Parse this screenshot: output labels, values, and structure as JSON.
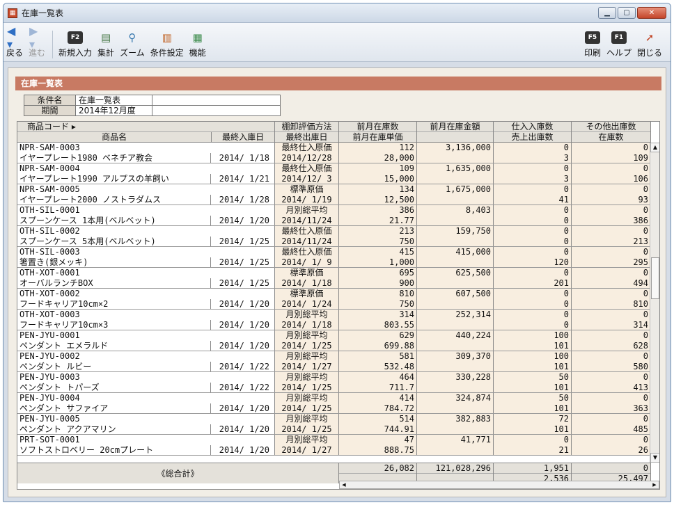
{
  "window": {
    "title": "在庫一覧表"
  },
  "toolbar": {
    "back": "戻る",
    "forward": "進む",
    "new": "新規入力",
    "total": "集計",
    "zoom": "ズーム",
    "condition": "条件設定",
    "function": "機能",
    "print": "印刷",
    "help": "ヘルプ",
    "close": "閉じる",
    "f2": "F2",
    "f5": "F5",
    "f1": "F1"
  },
  "section": {
    "title": "在庫一覧表"
  },
  "conditions": {
    "name_label": "条件名",
    "name_value": "在庫一覧表",
    "period_label": "期間",
    "period_value": "2014年12月度"
  },
  "header": {
    "code": "商品コード ▸",
    "name": "商品名",
    "last_in": "最終入庫日",
    "method": "棚卸評価方法",
    "last_out": "最終出庫日",
    "prev_qty": "前月在庫数",
    "prev_price": "前月在庫単価",
    "prev_amount": "前月在庫金額",
    "in_qty": "仕入入庫数",
    "sales_out": "売上出庫数",
    "other_out": "その他出庫数",
    "stock": "在庫数"
  },
  "rows": [
    {
      "code": "NPR-SAM-0003",
      "name": "イヤープレート1980 ベネチア教会",
      "in": "2014/ 1/18",
      "method": "最終仕入原価",
      "out": "2014/12/28",
      "pq": "112",
      "pp": "28,000",
      "amt": "3,136,000",
      "iq": "0",
      "so": "3",
      "oo": "0",
      "st": "109"
    },
    {
      "code": "NPR-SAM-0004",
      "name": "イヤープレート1990 アルプスの羊飼い",
      "in": "2014/ 1/21",
      "method": "最終仕入原価",
      "out": "2014/12/ 3",
      "pq": "109",
      "pp": "15,000",
      "amt": "1,635,000",
      "iq": "0",
      "so": "3",
      "oo": "0",
      "st": "106"
    },
    {
      "code": "NPR-SAM-0005",
      "name": "イヤープレート2000 ノストラダムス",
      "in": "2014/ 1/28",
      "method": "標準原価",
      "out": "2014/ 1/19",
      "pq": "134",
      "pp": "12,500",
      "amt": "1,675,000",
      "iq": "0",
      "so": "41",
      "oo": "0",
      "st": "93"
    },
    {
      "code": "OTH-SIL-0001",
      "name": "スプーンケース 1本用(ベルベット)",
      "in": "2014/ 1/20",
      "method": "月別総平均",
      "out": "2014/11/24",
      "pq": "386",
      "pp": "21.77",
      "amt": "8,403",
      "iq": "0",
      "so": "0",
      "oo": "0",
      "st": "386"
    },
    {
      "code": "OTH-SIL-0002",
      "name": "スプーンケース 5本用(ベルベット)",
      "in": "2014/ 1/25",
      "method": "最終仕入原価",
      "out": "2014/11/24",
      "pq": "213",
      "pp": "750",
      "amt": "159,750",
      "iq": "0",
      "so": "0",
      "oo": "0",
      "st": "213"
    },
    {
      "code": "OTH-SIL-0003",
      "name": "箸置き(銀メッキ)",
      "in": "2014/ 1/25",
      "method": "最終仕入原価",
      "out": "2014/ 1/ 9",
      "pq": "415",
      "pp": "1,000",
      "amt": "415,000",
      "iq": "0",
      "so": "120",
      "oo": "0",
      "st": "295"
    },
    {
      "code": "OTH-XOT-0001",
      "name": "オーバルランチBOX",
      "in": "2014/ 1/25",
      "method": "標準原価",
      "out": "2014/ 1/18",
      "pq": "695",
      "pp": "900",
      "amt": "625,500",
      "iq": "0",
      "so": "201",
      "oo": "0",
      "st": "494"
    },
    {
      "code": "OTH-XOT-0002",
      "name": "フードキャリア10cm×2",
      "in": "2014/ 1/20",
      "method": "標準原価",
      "out": "2014/ 1/24",
      "pq": "810",
      "pp": "750",
      "amt": "607,500",
      "iq": "0",
      "so": "0",
      "oo": "0",
      "st": "810"
    },
    {
      "code": "OTH-XOT-0003",
      "name": "フードキャリア10cm×3",
      "in": "2014/ 1/20",
      "method": "月別総平均",
      "out": "2014/ 1/18",
      "pq": "314",
      "pp": "803.55",
      "amt": "252,314",
      "iq": "0",
      "so": "0",
      "oo": "0",
      "st": "314"
    },
    {
      "code": "PEN-JYU-0001",
      "name": "ペンダント エメラルド",
      "in": "2014/ 1/20",
      "method": "月別総平均",
      "out": "2014/ 1/25",
      "pq": "629",
      "pp": "699.88",
      "amt": "440,224",
      "iq": "100",
      "so": "101",
      "oo": "0",
      "st": "628"
    },
    {
      "code": "PEN-JYU-0002",
      "name": "ペンダント ルビー",
      "in": "2014/ 1/22",
      "method": "月別総平均",
      "out": "2014/ 1/27",
      "pq": "581",
      "pp": "532.48",
      "amt": "309,370",
      "iq": "100",
      "so": "101",
      "oo": "0",
      "st": "580"
    },
    {
      "code": "PEN-JYU-0003",
      "name": "ペンダント トパーズ",
      "in": "2014/ 1/22",
      "method": "月別総平均",
      "out": "2014/ 1/25",
      "pq": "464",
      "pp": "711.7",
      "amt": "330,228",
      "iq": "50",
      "so": "101",
      "oo": "0",
      "st": "413"
    },
    {
      "code": "PEN-JYU-0004",
      "name": "ペンダント サファイア",
      "in": "2014/ 1/20",
      "method": "月別総平均",
      "out": "2014/ 1/25",
      "pq": "414",
      "pp": "784.72",
      "amt": "324,874",
      "iq": "50",
      "so": "101",
      "oo": "0",
      "st": "363"
    },
    {
      "code": "PEN-JYU-0005",
      "name": "ペンダント アクアマリン",
      "in": "2014/ 1/20",
      "method": "月別総平均",
      "out": "2014/ 1/25",
      "pq": "514",
      "pp": "744.91",
      "amt": "382,883",
      "iq": "72",
      "so": "101",
      "oo": "0",
      "st": "485"
    },
    {
      "code": "PRT-SOT-0001",
      "name": "ソフトストロベリー 20cmプレート",
      "in": "2014/ 1/20",
      "method": "月別総平均",
      "out": "2014/ 1/27",
      "pq": "47",
      "pp": "888.75",
      "amt": "41,771",
      "iq": "0",
      "so": "21",
      "oo": "0",
      "st": "26"
    }
  ],
  "totals": {
    "label": "《総合計》",
    "pq": "26,082",
    "amt": "121,028,296",
    "iq": "1,951",
    "so": "2,536",
    "oo": "0",
    "st": "25,497"
  }
}
